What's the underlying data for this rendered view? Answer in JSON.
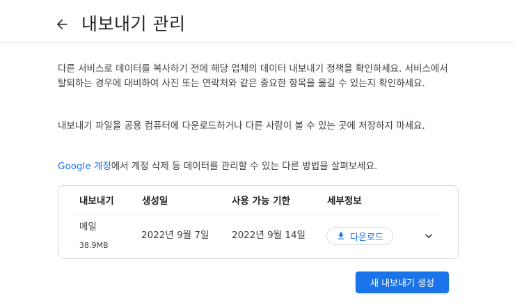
{
  "header": {
    "title": "내보내기 관리",
    "back_icon": "arrow-left-icon"
  },
  "info": {
    "p1": "다른 서비스로 데이터를 복사하기 전에 해당 업체의 데이터 내보내기 정책을 확인하세요. 서비스에서 탈퇴하는 경우에 대비하여 사진 또는 연락처와 같은 중요한 항목을 옮길 수 있는지 확인하세요.",
    "p2": "내보내기 파일을 공용 컴퓨터에 다운로드하거나 다른 사람이 볼 수 있는 곳에 저장하지 마세요.",
    "p3_link": "Google 계정",
    "p3_rest": "에서 계정 삭제 등 데이터를 관리할 수 있는 다른 방법을 살펴보세요."
  },
  "table": {
    "headers": [
      "내보내기",
      "생성일",
      "사용 가능 기한",
      "세부정보"
    ],
    "rows": [
      {
        "name": "메일",
        "size": "38.9MB",
        "created": "2022년 9월 7일",
        "expires": "2022년 9월 14일",
        "download_label": "다운로드",
        "download_icon": "download-icon",
        "expand_icon": "chevron-down-icon"
      }
    ]
  },
  "actions": {
    "create_label": "새 내보내기 생성"
  },
  "colors": {
    "accent": "#1a73e8",
    "text": "#202124",
    "border": "#dadce0"
  }
}
